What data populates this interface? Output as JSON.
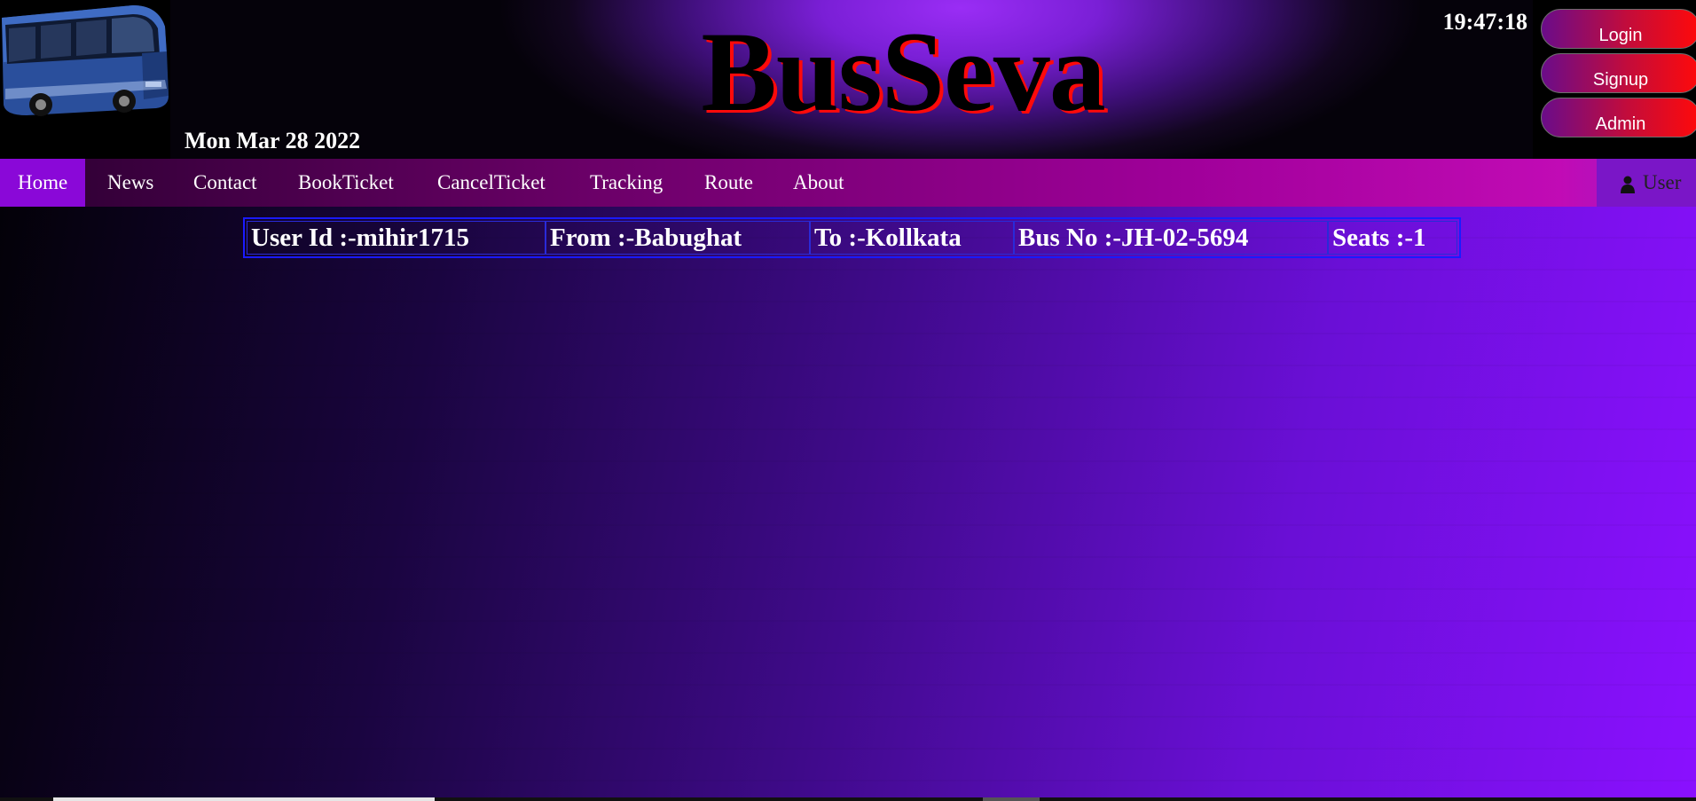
{
  "header": {
    "brand": "BusSeva",
    "date": "Mon Mar 28 2022",
    "clock": "19:47:18",
    "logo_icon": "bus-image"
  },
  "auth": {
    "login": "Login",
    "signup": "Signup",
    "admin": "Admin"
  },
  "nav": {
    "items": [
      "Home",
      "News",
      "Contact",
      "BookTicket",
      "CancelTicket",
      "Tracking",
      "Route",
      "About"
    ],
    "active": "Home",
    "user_label": "User",
    "user_icon": "person-icon"
  },
  "ticket": {
    "user_id": "User Id :-mihir1715",
    "from": "From :-Babughat",
    "to": "To :-Kollkata",
    "bus_no": "Bus No :-JH-02-5694",
    "seats": "Seats :-1"
  },
  "colors": {
    "accent_red": "#ff0a0a",
    "nav_active": "#8a08d8",
    "table_border": "#1a1aff"
  }
}
